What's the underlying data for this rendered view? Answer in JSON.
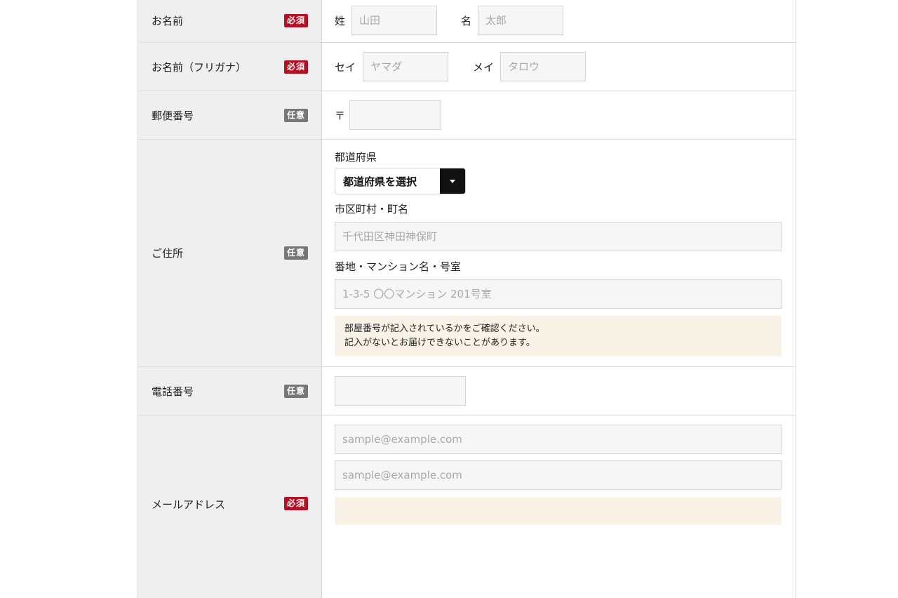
{
  "rows": {
    "name": {
      "label": "お名前",
      "badge": "必須",
      "last_label": "姓",
      "last_placeholder": "山田",
      "first_label": "名",
      "first_placeholder": "太郎"
    },
    "kana": {
      "label": "お名前（フリガナ）",
      "badge": "必須",
      "last_label": "セイ",
      "last_placeholder": "ヤマダ",
      "first_label": "メイ",
      "first_placeholder": "タロウ"
    },
    "postal": {
      "label": "郵便番号",
      "badge": "任意",
      "symbol": "〒",
      "value": ""
    },
    "address": {
      "label": "ご住所",
      "badge": "任意",
      "prefecture_label": "都道府県",
      "prefecture_selected": "都道府県を選択",
      "city_label": "市区町村・町名",
      "city_placeholder": "千代田区神田神保町",
      "street_label": "番地・マンション名・号室",
      "street_placeholder": "1-3-5 〇〇マンション 201号室",
      "note_line1": "部屋番号が記入されているかをご確認ください。",
      "note_line2": "記入がないとお届けできないことがあります。"
    },
    "phone": {
      "label": "電話番号",
      "badge": "任意",
      "value": ""
    },
    "email": {
      "label": "メールアドレス",
      "badge": "必須",
      "placeholder": "sample@example.com",
      "confirm_placeholder": "sample@example.com"
    }
  },
  "colors": {
    "required_badge": "#b40f23",
    "optional_badge": "#777777",
    "note_background": "#f8f3e6"
  }
}
